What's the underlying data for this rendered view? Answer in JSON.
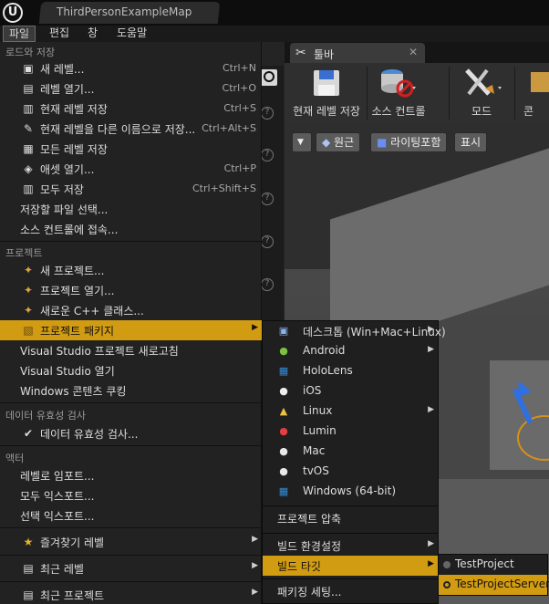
{
  "window": {
    "tab_title": "ThirdPersonExampleMap"
  },
  "menubar": {
    "items": [
      "파일",
      "편집",
      "창",
      "도움말"
    ]
  },
  "toolbar": {
    "tab_label": "툴바",
    "buttons": [
      {
        "label": "현재 레벨 저장",
        "icon": "save-icon"
      },
      {
        "label": "소스 컨트롤",
        "icon": "source-control-icon"
      },
      {
        "label": "모드",
        "icon": "modes-icon"
      },
      {
        "label": "콘",
        "icon": "content-icon"
      }
    ]
  },
  "viewport": {
    "buttons": [
      "원근",
      "라이팅포함",
      "표시"
    ]
  },
  "file_menu": {
    "sections": [
      {
        "header": "로드와 저장",
        "items": [
          {
            "label": "새 레벨...",
            "shortcut": "Ctrl+N",
            "icon": "new-level-icon"
          },
          {
            "label": "레벨 열기...",
            "shortcut": "Ctrl+O",
            "icon": "open-level-icon"
          },
          {
            "label": "현재 레벨 저장",
            "shortcut": "Ctrl+S",
            "icon": "save-icon"
          },
          {
            "label": "현재 레벨을 다른 이름으로 저장...",
            "shortcut": "Ctrl+Alt+S",
            "icon": "save-as-icon"
          },
          {
            "label": "모든 레벨 저장",
            "shortcut": "",
            "icon": "save-all-levels-icon"
          },
          {
            "label": "애셋 열기...",
            "shortcut": "Ctrl+P",
            "icon": "open-asset-icon"
          },
          {
            "label": "모두 저장",
            "shortcut": "Ctrl+Shift+S",
            "icon": "save-all-icon"
          },
          {
            "label": "저장할 파일 선택...",
            "shortcut": ""
          },
          {
            "label": "소스 컨트롤에 접속...",
            "shortcut": ""
          }
        ]
      },
      {
        "header": "프로젝트",
        "items": [
          {
            "label": "새 프로젝트...",
            "icon": "new-project-icon"
          },
          {
            "label": "프로젝트 열기...",
            "icon": "open-project-icon"
          },
          {
            "label": "새로운 C++ 클래스...",
            "icon": "cpp-class-icon"
          },
          {
            "label": "프로젝트 패키지",
            "icon": "package-icon",
            "submenu": true
          },
          {
            "label": "Visual Studio 프로젝트 새로고침"
          },
          {
            "label": "Visual Studio 열기"
          },
          {
            "label": "Windows 콘텐츠 쿠킹"
          }
        ]
      },
      {
        "header": "데이터 유효성 검사",
        "items": [
          {
            "label": "데이터 유효성 검사...",
            "icon": "validate-icon"
          }
        ]
      },
      {
        "header": "액터",
        "items": [
          {
            "label": "레벨로 임포트..."
          },
          {
            "label": "모두 익스포트..."
          },
          {
            "label": "선택 익스포트..."
          }
        ]
      }
    ],
    "bottom_items": [
      {
        "label": "즐겨찾기 레벨",
        "icon": "star-icon"
      },
      {
        "label": "최근 레벨",
        "icon": "recent-level-icon"
      },
      {
        "label": "최근 프로젝트",
        "icon": "recent-project-icon"
      }
    ]
  },
  "package_submenu": {
    "platforms": [
      {
        "label": "데스크톱 (Win+Mac+Linux)",
        "icon": "desktop-icon",
        "submenu": true
      },
      {
        "label": "Android",
        "icon": "android-icon",
        "submenu": true
      },
      {
        "label": "HoloLens",
        "icon": "windows-icon"
      },
      {
        "label": "iOS",
        "icon": "ios-icon"
      },
      {
        "label": "Linux",
        "icon": "linux-icon",
        "submenu": true
      },
      {
        "label": "Lumin",
        "icon": "lumin-icon"
      },
      {
        "label": "Mac",
        "icon": "apple-icon"
      },
      {
        "label": "tvOS",
        "icon": "apple-icon"
      },
      {
        "label": "Windows (64-bit)",
        "icon": "windows-icon"
      }
    ],
    "zip_project": "프로젝트 압축",
    "build_configuration": "빌드 환경설정",
    "build_target": "빌드 타깃",
    "packaging_settings": "패키징 세팅..."
  },
  "build_target_submenu": {
    "items": [
      {
        "label": "TestProject",
        "selected": false
      },
      {
        "label": "TestProjectServer",
        "selected": true
      }
    ]
  },
  "colors": {
    "highlight": "#d19b12",
    "menu_bg": "#222222",
    "radio_selected": "#d4901a"
  }
}
